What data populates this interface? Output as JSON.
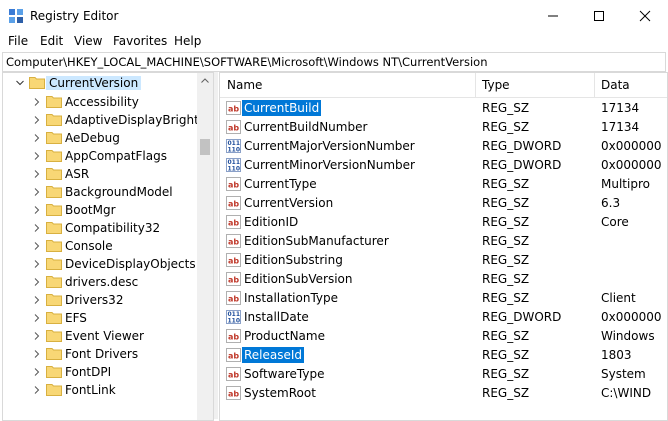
{
  "window": {
    "title": "Registry Editor",
    "icon": "registry-editor-icon"
  },
  "menu": [
    "File",
    "Edit",
    "View",
    "Favorites",
    "Help"
  ],
  "address": "Computer\\HKEY_LOCAL_MACHINE\\SOFTWARE\\Microsoft\\Windows NT\\CurrentVersion",
  "tree": {
    "selected": "CurrentVersion",
    "children": [
      "Accessibility",
      "AdaptiveDisplayBrightne",
      "AeDebug",
      "AppCompatFlags",
      "ASR",
      "BackgroundModel",
      "BootMgr",
      "Compatibility32",
      "Console",
      "DeviceDisplayObjects",
      "drivers.desc",
      "Drivers32",
      "EFS",
      "Event Viewer",
      "Font Drivers",
      "FontDPI",
      "FontLink"
    ]
  },
  "columns": {
    "name": "Name",
    "type": "Type",
    "data": "Data"
  },
  "values": [
    {
      "name": "CurrentBuild",
      "type": "REG_SZ",
      "data": "17134",
      "icon": "string-value-icon",
      "selected": true
    },
    {
      "name": "CurrentBuildNumber",
      "type": "REG_SZ",
      "data": "17134",
      "icon": "string-value-icon"
    },
    {
      "name": "CurrentMajorVersionNumber",
      "type": "REG_DWORD",
      "data": "0x000000",
      "icon": "binary-value-icon"
    },
    {
      "name": "CurrentMinorVersionNumber",
      "type": "REG_DWORD",
      "data": "0x000000",
      "icon": "binary-value-icon"
    },
    {
      "name": "CurrentType",
      "type": "REG_SZ",
      "data": "Multipro",
      "icon": "string-value-icon"
    },
    {
      "name": "CurrentVersion",
      "type": "REG_SZ",
      "data": "6.3",
      "icon": "string-value-icon"
    },
    {
      "name": "EditionID",
      "type": "REG_SZ",
      "data": "Core",
      "icon": "string-value-icon"
    },
    {
      "name": "EditionSubManufacturer",
      "type": "REG_SZ",
      "data": "",
      "icon": "string-value-icon"
    },
    {
      "name": "EditionSubstring",
      "type": "REG_SZ",
      "data": "",
      "icon": "string-value-icon"
    },
    {
      "name": "EditionSubVersion",
      "type": "REG_SZ",
      "data": "",
      "icon": "string-value-icon"
    },
    {
      "name": "InstallationType",
      "type": "REG_SZ",
      "data": "Client",
      "icon": "string-value-icon"
    },
    {
      "name": "InstallDate",
      "type": "REG_DWORD",
      "data": "0x000000",
      "icon": "binary-value-icon"
    },
    {
      "name": "ProductName",
      "type": "REG_SZ",
      "data": "Windows",
      "icon": "string-value-icon"
    },
    {
      "name": "ReleaseId",
      "type": "REG_SZ",
      "data": "1803",
      "icon": "string-value-icon",
      "selected": true
    },
    {
      "name": "SoftwareType",
      "type": "REG_SZ",
      "data": "System",
      "icon": "string-value-icon"
    },
    {
      "name": "SystemRoot",
      "type": "REG_SZ",
      "data": "C:\\WIND",
      "icon": "string-value-icon"
    }
  ],
  "colors": {
    "selection": "#0078d7",
    "tree_selection": "#cce8ff",
    "folder": "#f8d775",
    "string_icon": "#c0392b",
    "dword_icon": "#1f4e9c"
  }
}
